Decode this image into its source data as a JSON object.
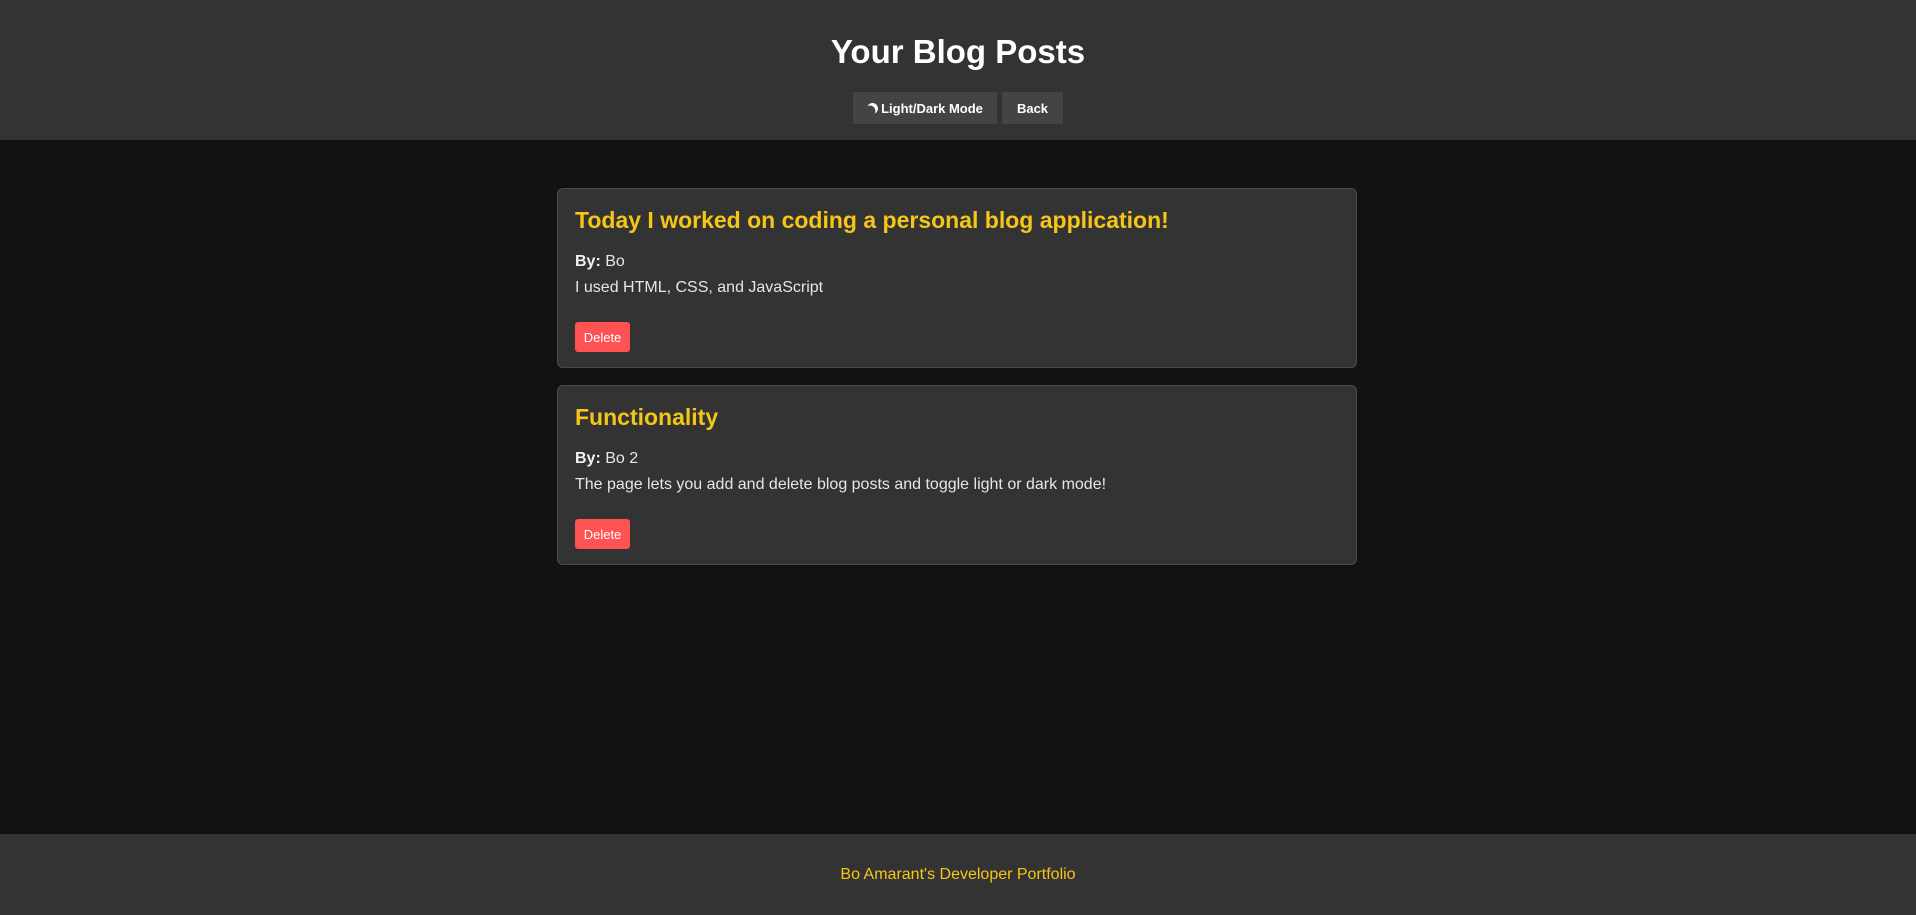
{
  "header": {
    "title": "Your Blog Posts",
    "theme_button": {
      "icon": "moon-icon",
      "label": "Light/Dark Mode"
    },
    "back_button": {
      "label": "Back"
    }
  },
  "posts": [
    {
      "title": "Today I worked on coding a personal blog application!",
      "by_label": "By:",
      "author": "Bo",
      "content": "I used HTML, CSS, and JavaScript",
      "delete_label": "Delete"
    },
    {
      "title": "Functionality",
      "by_label": "By:",
      "author": "Bo 2",
      "content": "The page lets you add and delete blog posts and toggle light or dark mode!",
      "delete_label": "Delete"
    }
  ],
  "footer": {
    "link_text": "Bo Amarant's Developer Portfolio"
  },
  "colors": {
    "background": "#121212",
    "surface": "#333333",
    "accent": "#f5c518",
    "delete": "#ff5252"
  }
}
